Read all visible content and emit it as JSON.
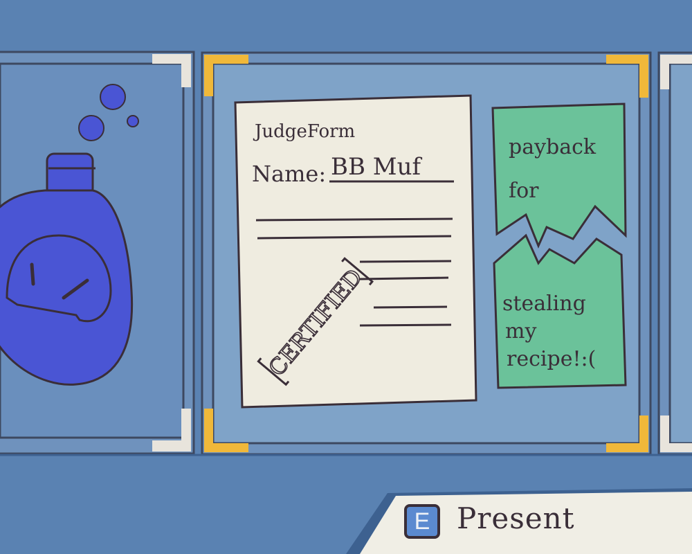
{
  "scene": {
    "left_item": "potion-bottle",
    "center_item": "judge-form",
    "right_item": "torn-note"
  },
  "judge_form": {
    "title": "JudgeForm",
    "name_label": "Name:",
    "name_value": "BB Muf",
    "stamp": "CERTIFIED"
  },
  "torn_note": {
    "top_line1": "payback",
    "top_line2": "for",
    "bottom_line1": "stealing",
    "bottom_line2": "my",
    "bottom_line3": "recipe!:("
  },
  "prompt": {
    "key": "E",
    "label": "Present"
  },
  "colors": {
    "background": "#5a82b2",
    "card_outer": "#6f92bd",
    "card_inner": "#7fa3c8",
    "selected_corner": "#f0b83a",
    "paper": "#efece0",
    "note": "#6bc29a",
    "potion": "#4a55d4",
    "ink": "#3a2e38"
  }
}
